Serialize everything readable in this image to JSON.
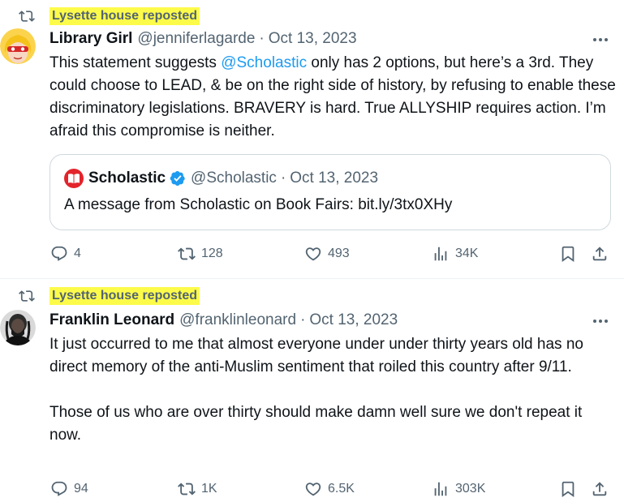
{
  "posts": [
    {
      "reposted_by": "Lysette house reposted",
      "author_name": "Library Girl",
      "author_handle": "@jenniferlagarde",
      "separator": "·",
      "date": "Oct 13, 2023",
      "text_before_mention": "This statement suggests ",
      "mention": "@Scholastic",
      "text_after_mention": " only has 2 options, but here’s a 3rd. They could choose to LEAD, & be on the right side of history, by refusing to enable these discriminatory legislations. BRAVERY is hard. True ALLYSHIP requires action. I’m afraid this compromise is neither.",
      "quote": {
        "author_name": "Scholastic",
        "author_handle": "@Scholastic",
        "separator": "·",
        "date": "Oct 13, 2023",
        "text": "A message from Scholastic on Book Fairs: bit.ly/3tx0XHy",
        "verified": true
      },
      "replies": "4",
      "reposts": "128",
      "likes": "493",
      "views": "34K"
    },
    {
      "reposted_by": "Lysette house reposted",
      "author_name": "Franklin Leonard",
      "author_handle": "@franklinleonard",
      "separator": "·",
      "date": "Oct 13, 2023",
      "paragraph_1": "It just occurred to me that almost everyone under under thirty years old has no direct memory of the anti-Muslim sentiment that roiled this country after 9/11.",
      "paragraph_2": "Those of us who are over thirty should make damn well sure we don't repeat it now.",
      "replies": "94",
      "reposts": "1K",
      "likes": "6.5K",
      "views": "303K"
    }
  ],
  "icons": {
    "repost": "repost-icon",
    "reply": "reply-icon",
    "like": "heart-icon",
    "views": "views-icon",
    "bookmark": "bookmark-icon",
    "share": "share-icon",
    "more": "more-icon",
    "verified": "verified-badge-icon",
    "quote_logo": "scholastic-logo"
  },
  "colors": {
    "highlight": "#fdfb4a",
    "link": "#1d9bf0",
    "muted": "#536471",
    "verified": "#1d9bf0",
    "scholastic_red": "#e3242b"
  }
}
